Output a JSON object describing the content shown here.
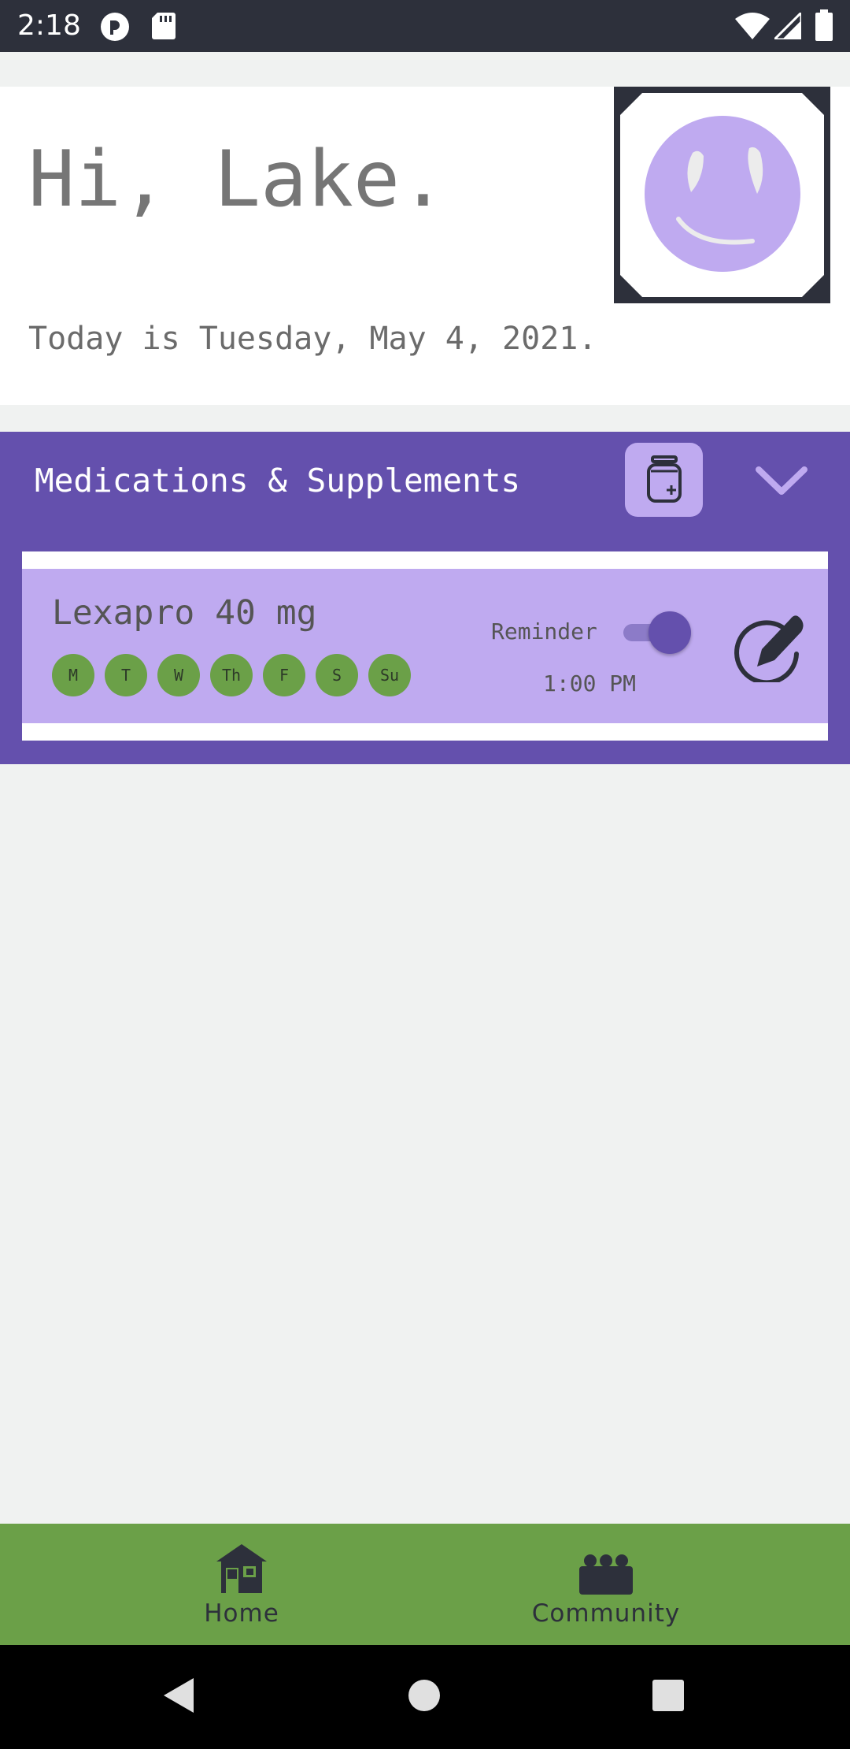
{
  "status_bar": {
    "time": "2:18",
    "icons": [
      "app-notification-icon",
      "sd-card-icon",
      "wifi-icon",
      "signal-icon",
      "battery-icon"
    ]
  },
  "header": {
    "greeting": "Hi, Lake.",
    "date_text": "Today is Tuesday, May 4, 2021.",
    "avatar_icon": "smiley-face-icon"
  },
  "medications": {
    "title": "Medications & Supplements",
    "add_icon": "medicine-bottle-icon",
    "collapse_icon": "chevron-down-icon",
    "items": [
      {
        "name": "Lexapro 40 mg",
        "days": [
          "M",
          "T",
          "W",
          "Th",
          "F",
          "S",
          "Su"
        ],
        "reminder_label": "Reminder",
        "reminder_enabled": true,
        "reminder_time": "1:00 PM",
        "edit_icon": "edit-pencil-icon"
      }
    ]
  },
  "bottom_nav": {
    "items": [
      {
        "label": "Home",
        "icon": "home-icon"
      },
      {
        "label": "Community",
        "icon": "community-icon"
      }
    ]
  },
  "colors": {
    "primary_purple": "#6450ad",
    "light_purple": "#bfaaf0",
    "green": "#6ba048",
    "dark": "#2d303b",
    "background": "#f0f2f1"
  }
}
